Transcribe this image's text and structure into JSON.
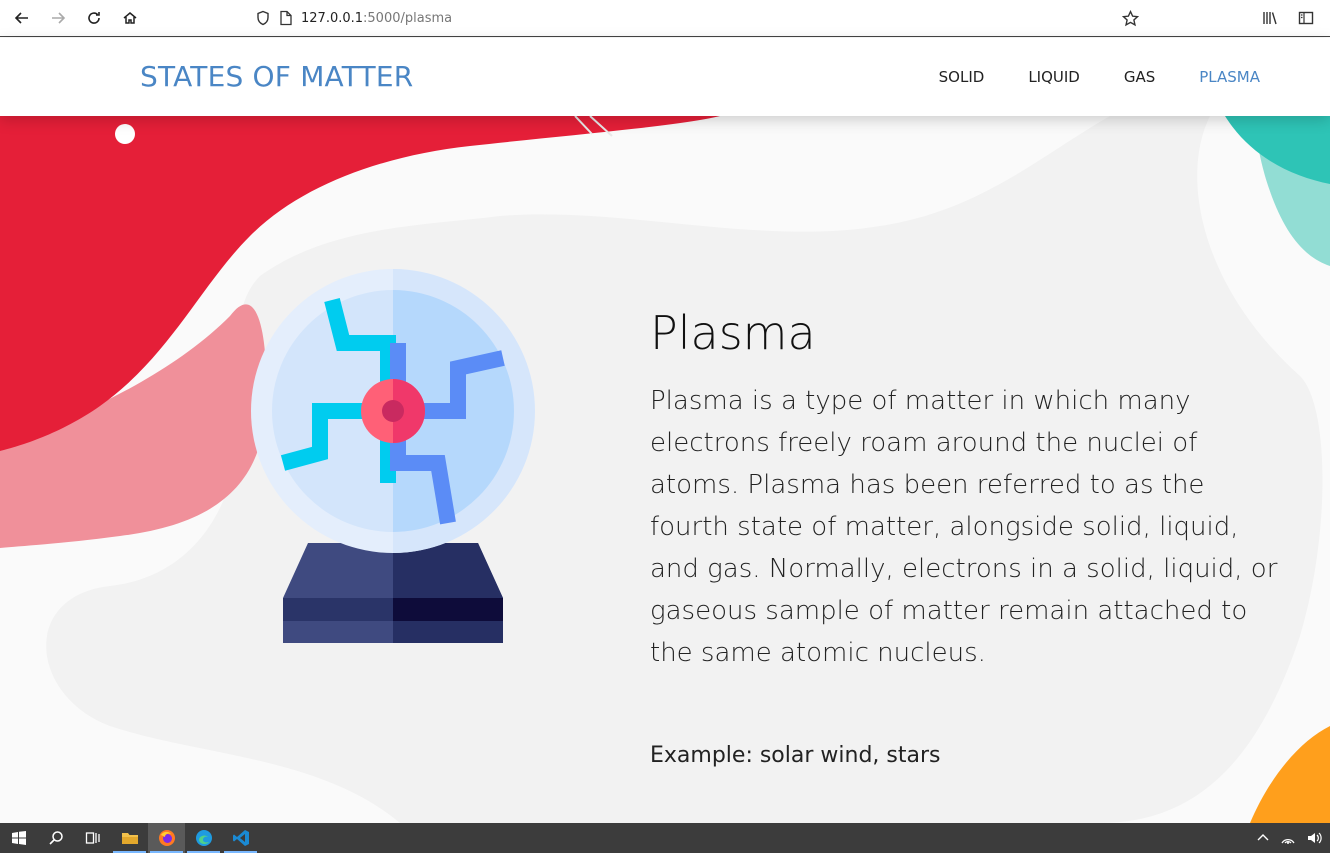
{
  "browser": {
    "url_host": "127.0.0.1",
    "url_path": ":5000/plasma"
  },
  "header": {
    "brand": "STATES OF MATTER",
    "nav": [
      "SOLID",
      "LIQUID",
      "GAS",
      "PLASMA"
    ],
    "active": "PLASMA"
  },
  "main": {
    "title": "Plasma",
    "description": "Plasma is a type of matter in which many electrons freely roam around the nuclei of atoms. Plasma has been referred to as the fourth state of matter, alongside solid, liquid, and gas. Normally, electrons in a solid, liquid, or gaseous sample of matter remain attached to the same atomic nucleus.",
    "example": "Example: solar wind, stars"
  },
  "colors": {
    "accent": "#4a86c5",
    "red_blob": "#e5203a",
    "pink_blob": "#f0909a",
    "teal_blob": "#2ec4b6",
    "orange_blob": "#ff9f1c"
  },
  "taskbar": {
    "apps": [
      "windows-start",
      "search",
      "task-view",
      "file-explorer",
      "firefox",
      "edge",
      "vscode"
    ]
  }
}
